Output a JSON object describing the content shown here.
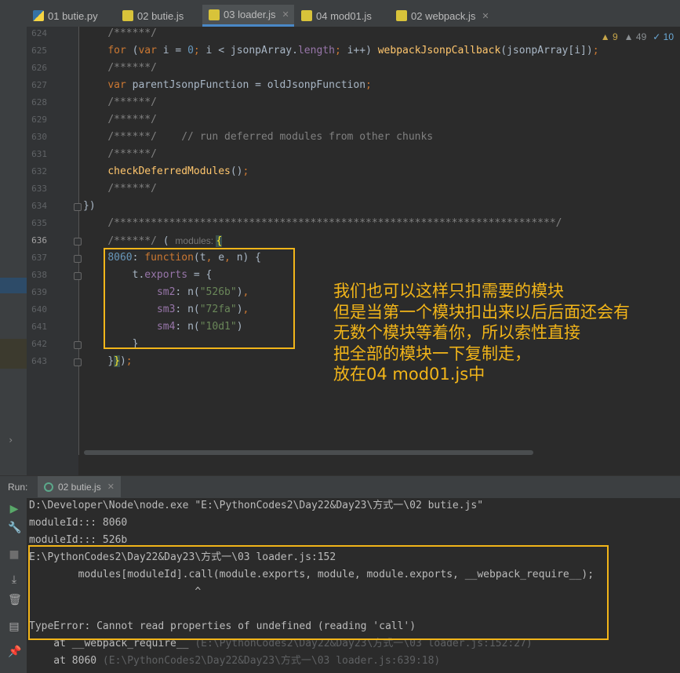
{
  "tabs": [
    {
      "label": "01 butie.py",
      "icon": "python-file-icon",
      "active": false
    },
    {
      "label": "02 butie.js",
      "icon": "js-file-icon",
      "active": false
    },
    {
      "label": "03 loader.js",
      "icon": "js-file-icon",
      "active": true
    },
    {
      "label": "04 mod01.js",
      "icon": "js-file-icon",
      "active": false
    },
    {
      "label": "02 webpack.js",
      "icon": "js-file-icon",
      "active": false
    }
  ],
  "inspections": {
    "warnings": "9",
    "weak_warnings": "49",
    "typos": "10"
  },
  "editor": {
    "lines": [
      {
        "n": "624",
        "tokens": [
          [
            "cm",
            "/******/"
          ]
        ]
      },
      {
        "n": "625",
        "tokens": [
          [
            "kw",
            "for "
          ],
          [
            "",
            "("
          ],
          [
            "kw",
            "var"
          ],
          [
            "",
            " i = "
          ],
          [
            "num",
            "0"
          ],
          [
            "kw",
            ";"
          ],
          [
            "",
            " i < jsonpArray."
          ],
          [
            "prop",
            "length"
          ],
          [
            "kw",
            ";"
          ],
          [
            "",
            " i++) "
          ],
          [
            "fn",
            "webpackJsonpCallback"
          ],
          [
            "",
            "(jsonpArray[i])"
          ],
          [
            "kw",
            ";"
          ]
        ]
      },
      {
        "n": "626",
        "tokens": [
          [
            "cm",
            "/******/"
          ]
        ]
      },
      {
        "n": "627",
        "tokens": [
          [
            "kw",
            "var"
          ],
          [
            "",
            " parentJsonpFunction = oldJsonpFunction"
          ],
          [
            "kw",
            ";"
          ]
        ]
      },
      {
        "n": "628",
        "tokens": [
          [
            "cm",
            "/******/"
          ]
        ]
      },
      {
        "n": "629",
        "tokens": [
          [
            "cm",
            "/******/"
          ]
        ]
      },
      {
        "n": "630",
        "tokens": [
          [
            "cm",
            "/******/    // run deferred modules from other chunks"
          ]
        ]
      },
      {
        "n": "631",
        "tokens": [
          [
            "cm",
            "/******/"
          ]
        ]
      },
      {
        "n": "632",
        "tokens": [
          [
            "fn",
            "checkDeferredModules"
          ],
          [
            "",
            "()"
          ],
          [
            "kw",
            ";"
          ]
        ]
      },
      {
        "n": "633",
        "tokens": [
          [
            "cm",
            "/******/"
          ]
        ]
      },
      {
        "n": "634",
        "tokens": [
          [
            "",
            "})"
          ]
        ]
      },
      {
        "n": "635",
        "tokens": [
          [
            "cm",
            "/************************************************************************/"
          ]
        ]
      },
      {
        "n": "636",
        "tokens": [
          [
            "cm",
            "/******/ "
          ],
          [
            "",
            "( "
          ],
          [
            "hint",
            "modules: "
          ],
          [
            "bracehl",
            "{"
          ]
        ]
      },
      {
        "n": "637",
        "tokens": [
          [
            "lbl",
            "8060"
          ],
          [
            "",
            ": "
          ],
          [
            "kw",
            "function"
          ],
          [
            "",
            "(t"
          ],
          [
            "kw",
            ","
          ],
          [
            "",
            " e"
          ],
          [
            "kw",
            ","
          ],
          [
            "",
            " n) {"
          ]
        ]
      },
      {
        "n": "638",
        "tokens": [
          [
            "",
            "    t."
          ],
          [
            "prop",
            "exports"
          ],
          [
            "",
            " = {"
          ]
        ]
      },
      {
        "n": "639",
        "tokens": [
          [
            "",
            "        "
          ],
          [
            "prop",
            "sm2"
          ],
          [
            "",
            ": n("
          ],
          [
            "str",
            "\"526b\""
          ],
          [
            "",
            ")"
          ],
          [
            "kw",
            ","
          ]
        ]
      },
      {
        "n": "640",
        "tokens": [
          [
            "",
            "        "
          ],
          [
            "prop",
            "sm3"
          ],
          [
            "",
            ": n("
          ],
          [
            "str",
            "\"72fa\""
          ],
          [
            "",
            ")"
          ],
          [
            "kw",
            ","
          ]
        ]
      },
      {
        "n": "641",
        "tokens": [
          [
            "",
            "        "
          ],
          [
            "prop",
            "sm4"
          ],
          [
            "",
            ": n("
          ],
          [
            "str",
            "\"10d1\""
          ],
          [
            "",
            ")"
          ]
        ]
      },
      {
        "n": "642",
        "tokens": [
          [
            "",
            "    }"
          ]
        ]
      },
      {
        "n": "643",
        "tokens": [
          [
            "",
            "}"
          ],
          [
            "bracehl",
            "}"
          ],
          [
            "",
            ")"
          ],
          [
            "kw",
            ";"
          ]
        ]
      }
    ]
  },
  "annotation": {
    "lines": [
      "我们也可以这样只扣需要的模块",
      "但是当第一个模块扣出来以后后面还会有",
      "无数个模块等着你，所以索性直接",
      "把全部的模块一下复制走，",
      "放在04 mod01.js中"
    ]
  },
  "run": {
    "label": "Run:",
    "tab": "02 butie.js",
    "console": [
      {
        "text": "D:\\Developer\\Node\\node.exe \"E:\\PythonCodes2\\Day22&Day23\\方式一\\02 butie.js\"",
        "dim": false
      },
      {
        "text": "moduleId::: 8060",
        "dim": false
      },
      {
        "text": "moduleId::: 526b",
        "dim": false
      },
      {
        "text": "E:\\PythonCodes2\\Day22&Day23\\方式一\\03 loader.js:152",
        "dim": false
      },
      {
        "text": "        modules[moduleId].call(module.exports, module, module.exports, __webpack_require__);",
        "dim": false
      },
      {
        "text": "                           ^",
        "dim": false
      },
      {
        "text": "",
        "dim": false
      },
      {
        "text": "TypeError: Cannot read properties of undefined (reading 'call')",
        "dim": false
      },
      {
        "text": "    at __webpack_require__ ",
        "path": "(E:\\PythonCodes2\\Day22&Day23\\方式一\\03 loader.js:152:27)",
        "dim": true
      },
      {
        "text": "    at 8060 ",
        "path": "(E:\\PythonCodes2\\Day22&Day23\\方式一\\03 loader.js:639:18)",
        "dim": true
      }
    ]
  },
  "colors": {
    "accent": "#f2b519",
    "active_tab": "#4a88c7"
  }
}
